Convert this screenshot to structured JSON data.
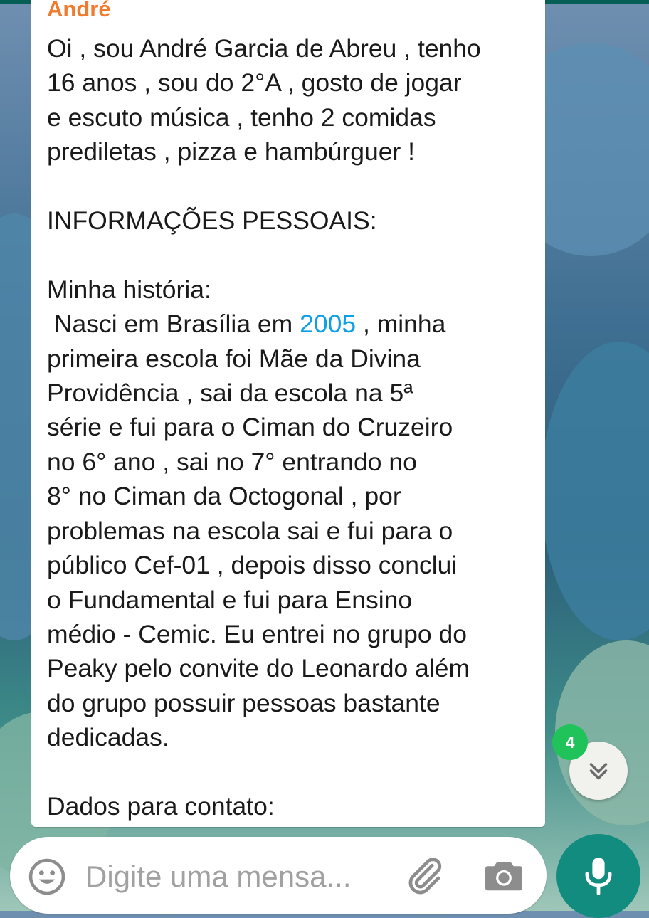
{
  "message": {
    "sender": "André",
    "text_before_link": "Oi , sou André Garcia de Abreu , tenho\n16 anos , sou do 2°A , gosto de jogar\ne escuto música , tenho 2 comidas\nprediletas , pizza e hambúrguer !\n\nINFORMAÇÕES PESSOAIS:\n\nMinha história:\n Nasci em Brasília em ",
    "link_text": "2005",
    "text_after_link": " , minha\nprimeira escola foi Mãe da Divina\nProvidência , sai da escola na 5ª\nsérie e fui para o Ciman do Cruzeiro\nno 6° ano , sai no 7° entrando no\n8° no Ciman da Octogonal , por\nproblemas na escola sai e fui para o\npúblico Cef-01 , depois disso conclui\no Fundamental e fui para Ensino\nmédio - Cemic. Eu entrei no grupo do\nPeaky pelo convite do Leonardo além\ndo grupo possuir pessoas bastante\ndedicadas.\n\nDados para contato:"
  },
  "scroll_button": {
    "unread_count": "4",
    "icon": "double-chevron-down-icon"
  },
  "composer": {
    "placeholder": "Digite uma mensa...",
    "emoji_icon": "emoji-icon",
    "attach_icon": "paperclip-icon",
    "camera_icon": "camera-icon"
  },
  "mic_button": {
    "icon": "microphone-icon"
  },
  "colors": {
    "header_strip": "#075e54",
    "sender_name": "#ef7b2e",
    "link": "#0f9fe6",
    "unread_badge": "#1fc35a",
    "mic_button": "#128c7e"
  }
}
